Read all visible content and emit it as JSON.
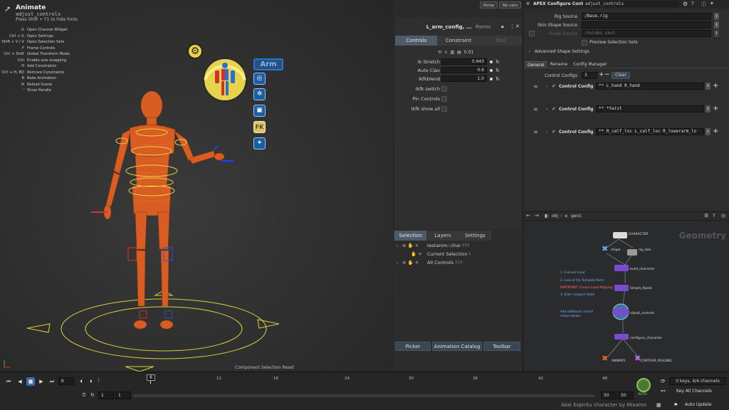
{
  "viewport": {
    "title": "Animate",
    "subtitle": "adjust_controls",
    "hint": "Press Shift + F1 to hide hints",
    "hotkeys": [
      {
        "key": "G",
        "label": "Open Channel Widget"
      },
      {
        "key": "Ctrl + G",
        "label": "Open Settings"
      },
      {
        "key": "Shift + V / V",
        "label": "Open Selection Sets"
      },
      {
        "key": "F",
        "label": "Frame Controls"
      },
      {
        "key": "Ctrl + Shift",
        "label": "Global Transform Mode"
      },
      {
        "key": "Ctrl",
        "label": "Enable axis snapping"
      },
      {
        "key": "H",
        "label": "Add Constraints"
      },
      {
        "key": "Ctrl + H, BD",
        "label": "Remove Constraints"
      },
      {
        "key": "B",
        "label": "Bake Animation"
      },
      {
        "key": "N",
        "label": "Reload Scene"
      },
      {
        "key": "'",
        "label": "Show Handle"
      }
    ],
    "persp": "Persp",
    "nocam": "No cam",
    "status_message": "Component Selection Reset",
    "credit": "Akai Espiritu character by Mixamo",
    "picker": {
      "arm_label": "Arm",
      "fk_label": "FK"
    }
  },
  "controls": {
    "title": "L_arm_config, ...",
    "parms_label": "Parms",
    "tabs": [
      "Controls",
      "Constraint",
      "Tool"
    ],
    "step_value": "0.01",
    "params": [
      {
        "label": "Ik Stretch",
        "value": "0.943"
      },
      {
        "label": "Auto Clav",
        "value": "0.6"
      },
      {
        "label": "Ikfkblend",
        "value": "1.0"
      }
    ],
    "toggles": [
      "Ikfk switch",
      "Pin Controls",
      "Ikfk show all"
    ]
  },
  "selection": {
    "tabs": [
      "Selection",
      "Layers",
      "Settings"
    ],
    "rows": [
      {
        "label": "testanim::char",
        "count": "151"
      },
      {
        "label": "Current Selection",
        "count": "1"
      },
      {
        "label": "All Controls",
        "count": "213"
      }
    ],
    "buttons": [
      "Picker",
      "Animation Catalog",
      "Toolbar"
    ]
  },
  "apex": {
    "header_title": "APEX Configure Controls",
    "header_node": "adjust_controls",
    "rig_source_label": "Rig Source",
    "rig_source_value": "/Base.rig",
    "skin_shape_label": "Skin Shape Source",
    "skin_shape_value": "",
    "guide_source_label": "Guide Source",
    "guide_source_value": "/Guides.skel",
    "preview_label": "Preview Selection Sets",
    "advanced_label": "Advanced Shape Settings",
    "tabs": [
      "General",
      "Rename",
      "Config Manager"
    ],
    "control_configs_label": "Control Configs",
    "control_configs_value": "3",
    "clear_label": "Clear",
    "configs": [
      {
        "label": "Control Config",
        "value": "** L_hand R_hand"
      },
      {
        "label": "Control Config",
        "value": "** *twist"
      },
      {
        "label": "Control Config",
        "value": "** R_calf_loc L_calf_loc R_lowerarm_lo"
      }
    ]
  },
  "network": {
    "path_obj": "obj",
    "path_geo": "geo1",
    "context_label": "Geometry",
    "nodes": {
      "character": "CHARACTER",
      "shape": "shape",
      "rig_skel": "rig_skel",
      "build_character": "build_character",
      "simple_biped": "Simple_Biped",
      "adjust_controls": "adjust_controls",
      "configure_character": "configure_character",
      "animate": "ANIMATE",
      "contour_rigging": "CONTOUR_RIGGING"
    },
    "notes": [
      "1. Connect Input",
      "2. Look at the Template Parm",
      "IMPORTANT: Choose Input Mapping",
      "3. Enter viewport State",
      "Add additional control",
      "shape tweaks"
    ]
  },
  "timeline": {
    "current_frame": "6",
    "frame_field": "6",
    "ticks": [
      "6",
      "12",
      "18",
      "24",
      "30",
      "36",
      "42",
      "48"
    ],
    "start_a": "1",
    "start_b": "1",
    "end_a": "50",
    "end_b": "50",
    "auto_label": "AUTO",
    "keys_label": "0 keys, 4/4 channels",
    "key_all_label": "Key All Channels",
    "auto_update_label": "Auto Update"
  },
  "colors": {
    "accent": "#4d5a68",
    "picker_blue": "#1c5da8",
    "character_orange": "#e0662a",
    "controls_yellow": "#e7d44b",
    "note_blue": "#7aa8ff",
    "node_purple": "#7a4ad0"
  }
}
